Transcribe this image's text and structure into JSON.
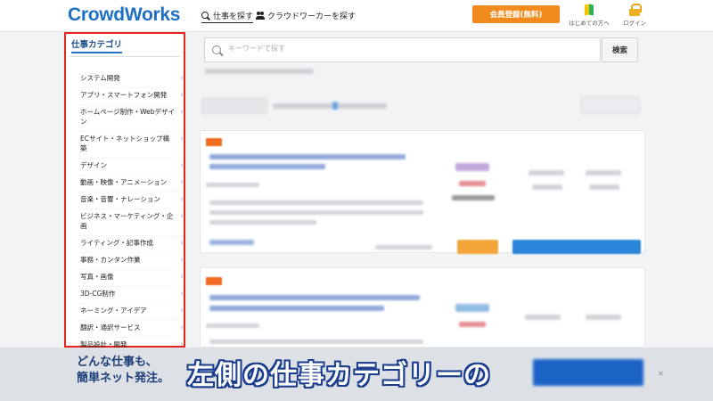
{
  "header": {
    "logo": "CrowdWorks",
    "nav_find_jobs": "仕事を探す",
    "nav_find_workers": "クラウドワーカーを探す",
    "register_button": "会員登録(無料)",
    "first_time_label": "はじめての方へ",
    "login_label": "ログイン"
  },
  "sidebar": {
    "title": "仕事カテゴリ",
    "items": [
      "システム開発",
      "アプリ・スマートフォン開発",
      "ホームページ制作・Webデザイン",
      "ECサイト・ネットショップ構築",
      "デザイン",
      "動画・映像・アニメーション",
      "音楽・音響・ナレーション",
      "ビジネス・マーケティング・企画",
      "ライティング・記事作成",
      "事務・カンタン作業",
      "写真・画像",
      "3D-CG制作",
      "ネーミング・アイデア",
      "翻訳・通訳サービス",
      "製品設計・開発"
    ]
  },
  "search": {
    "placeholder": "キーワードで探す",
    "button_label": "検索"
  },
  "banner": {
    "tagline": "どんな仕事も、\n簡単ネット発注。",
    "caption": "左側の仕事カテゴリーの",
    "close_label": "✕"
  },
  "colors": {
    "brand": "#1f6fc4",
    "register": "#f08a1c",
    "highlight_border": "#e8241e",
    "caption_outline": "#1a3c8c"
  }
}
